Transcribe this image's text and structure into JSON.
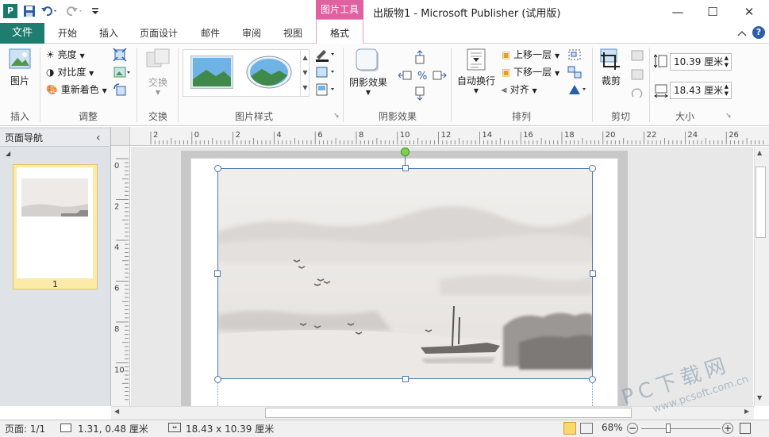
{
  "titlebar": {
    "tool_tab": "图片工具",
    "title": "出版物1 - Microsoft Publisher (试用版)",
    "minimize": "—",
    "maximize": "☐",
    "close": "✕"
  },
  "tabs": {
    "file": "文件",
    "items": [
      "开始",
      "插入",
      "页面设计",
      "邮件",
      "审阅",
      "视图"
    ],
    "format": "格式"
  },
  "ribbon": {
    "insert": {
      "picture": "图片",
      "group": "插入"
    },
    "adjust": {
      "brightness": "亮度",
      "contrast": "对比度",
      "recolor": "重新着色",
      "group": "调整"
    },
    "swap": {
      "swap": "交换",
      "group": "交换"
    },
    "picture_styles": {
      "group": "图片样式"
    },
    "shadow": {
      "shadow": "阴影效果",
      "group": "阴影效果"
    },
    "arrange": {
      "wrap": "自动换行",
      "forward": "上移一层",
      "backward": "下移一层",
      "align": "对齐",
      "group": "排列"
    },
    "crop": {
      "crop": "裁剪",
      "group": "剪切"
    },
    "size": {
      "height": "10.39 厘米",
      "width": "18.43 厘米",
      "group": "大小"
    }
  },
  "navpane": {
    "title": "页面导航",
    "collapse": "‹",
    "page_number": "1"
  },
  "hruler_ticks": [
    "2",
    "0",
    "2",
    "4",
    "6",
    "8",
    "10",
    "12",
    "14",
    "16",
    "18",
    "20",
    "22",
    "24",
    "26"
  ],
  "vruler_ticks": [
    "0",
    "2",
    "4",
    "6",
    "8",
    "10"
  ],
  "statusbar": {
    "page": "页面: 1/1",
    "position": "1.31, 0.48 厘米",
    "size": "18.43 x 10.39 厘米",
    "zoom": "68%"
  },
  "watermark": {
    "main": "PC下载网",
    "url": "www.pcsoft.com.cn"
  },
  "colors": {
    "file_tab": "#1e7d6e",
    "tool_tab": "#e060a0",
    "selection": "#4a7ab5"
  }
}
